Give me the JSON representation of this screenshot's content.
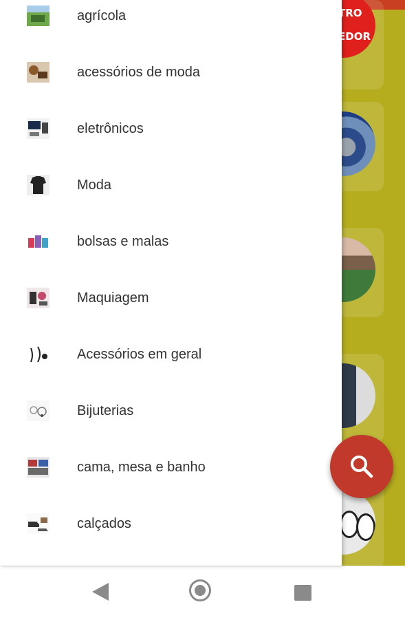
{
  "drawer": {
    "items": [
      {
        "label": "agrícola",
        "icon": "agriculture-thumbnail"
      },
      {
        "label": "acessórios de moda",
        "icon": "fashion-accessories-thumbnail"
      },
      {
        "label": "eletrônicos",
        "icon": "electronics-thumbnail"
      },
      {
        "label": "Moda",
        "icon": "fashion-thumbnail"
      },
      {
        "label": "bolsas e malas",
        "icon": "bags-thumbnail"
      },
      {
        "label": "Maquiagem",
        "icon": "makeup-thumbnail"
      },
      {
        "label": "Acessórios em geral",
        "icon": "general-accessories-thumbnail"
      },
      {
        "label": "Bijuterias",
        "icon": "jewelry-thumbnail"
      },
      {
        "label": "cama, mesa e banho",
        "icon": "bed-bath-thumbnail"
      },
      {
        "label": "calçados",
        "icon": "shoes-thumbnail"
      }
    ]
  },
  "background": {
    "logo_text_line1": "TRO",
    "logo_text_line2": "EDOR"
  },
  "fab": {
    "icon": "search-icon"
  },
  "navbar": {
    "back": "back-icon",
    "home": "home-icon",
    "recents": "recents-icon"
  },
  "colors": {
    "topbar": "#c8401f",
    "background": "#b6ad1e",
    "fab": "#c0392b",
    "text": "#333333"
  }
}
